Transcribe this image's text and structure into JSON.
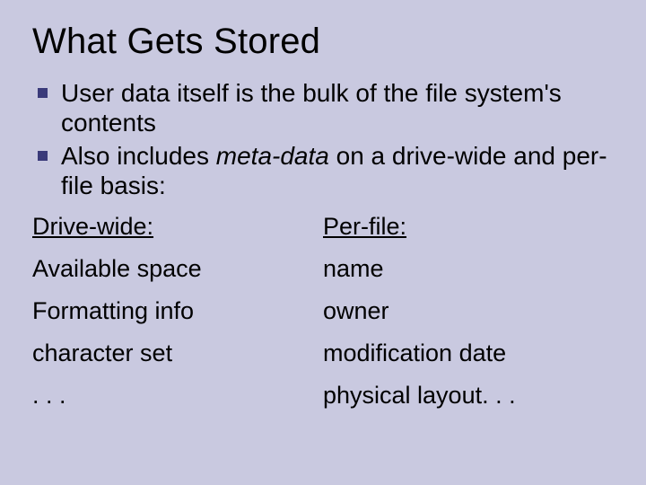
{
  "title": "What Gets Stored",
  "bullets": [
    {
      "pre": "User data itself is the bulk of the file system's contents"
    },
    {
      "pre": "Also includes ",
      "em": "meta-data",
      "post": " on a drive-wide and per-file basis:"
    }
  ],
  "columns": {
    "left_header": "Drive-wide:",
    "right_header": "Per-file:",
    "rows": [
      {
        "left": "Available space",
        "right": "name"
      },
      {
        "left": "Formatting info",
        "right": "owner"
      },
      {
        "left": "character set",
        "right": "modification date"
      },
      {
        "left": ". . .",
        "right": "physical layout. . ."
      }
    ]
  }
}
